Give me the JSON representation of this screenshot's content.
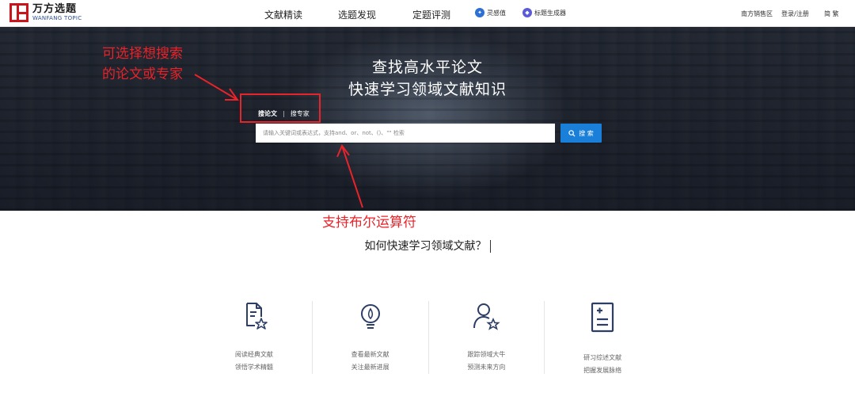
{
  "header": {
    "logo_cn": "万方选题",
    "logo_en": "WANFANG TOPIC",
    "tabs": [
      {
        "label": "文献精读",
        "active": true
      },
      {
        "label": "选题发现",
        "active": false
      },
      {
        "label": "定题评测",
        "active": false
      }
    ],
    "tools": [
      {
        "label": "灵感值",
        "icon": "lightbulb-icon",
        "color": "#2d6fd3"
      },
      {
        "label": "标题生成器",
        "icon": "title-generator-icon",
        "color": "#5a5bd6"
      }
    ],
    "region": "南方销售区",
    "login": "登录/注册",
    "lang": "简 繁"
  },
  "hero": {
    "title_line1": "查找高水平论文",
    "title_line2": "快速学习领域文献知识",
    "search_tabs": [
      {
        "label": "搜论文",
        "active": true
      },
      {
        "label": "搜专家",
        "active": false
      }
    ],
    "search_placeholder": "请输入关键词或表达式，支持and、or、not、()、\"\" 检索",
    "search_button": "搜 索"
  },
  "annotations": {
    "note1_line1": "可选择想搜索",
    "note1_line2": "的论文或专家",
    "note2": "支持布尔运算符",
    "color": "#e8232a"
  },
  "section": {
    "title": "如何快速学习领域文献？"
  },
  "features": [
    {
      "icon": "document-star-icon",
      "line1": "阅读经典文献",
      "line2": "领悟学术精髓"
    },
    {
      "icon": "bulb-icon",
      "line1": "查看最新文献",
      "line2": "关注最新进展"
    },
    {
      "icon": "user-star-icon",
      "line1": "跟踪领域大牛",
      "line2": "预测未来方向"
    },
    {
      "icon": "report-icon",
      "line1": "研习综述文献",
      "line2": "把握发展脉络"
    }
  ],
  "colors": {
    "brand_red": "#c8161d",
    "search_blue": "#1a7fd8",
    "icon_navy": "#2c3e66"
  }
}
